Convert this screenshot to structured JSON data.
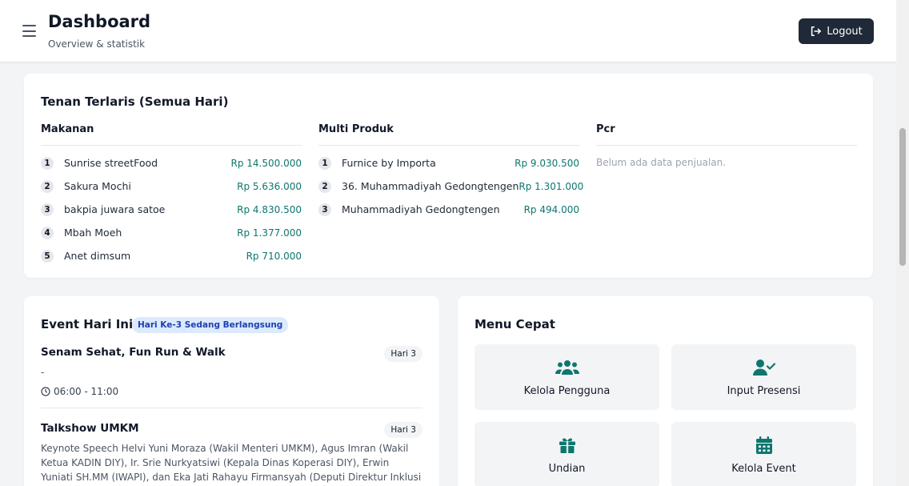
{
  "header": {
    "title": "Dashboard",
    "subtitle": "Overview & statistik",
    "logout_label": "Logout"
  },
  "top_tenants": {
    "title": "Tenan Terlaris (Semua Hari)",
    "columns": [
      {
        "name": "Makanan",
        "items": [
          {
            "rank": "1",
            "name": "Sunrise streetFood",
            "amount": "Rp 14.500.000"
          },
          {
            "rank": "2",
            "name": "Sakura Mochi",
            "amount": "Rp 5.636.000"
          },
          {
            "rank": "3",
            "name": "bakpia juwara satoe",
            "amount": "Rp 4.830.500"
          },
          {
            "rank": "4",
            "name": "Mbah Moeh",
            "amount": "Rp 1.377.000"
          },
          {
            "rank": "5",
            "name": "Anet dimsum",
            "amount": "Rp 710.000"
          }
        ]
      },
      {
        "name": "Multi Produk",
        "items": [
          {
            "rank": "1",
            "name": "Furnice by Importa",
            "amount": "Rp 9.030.500"
          },
          {
            "rank": "2",
            "name": "36. Muhammadiyah Gedongtengen",
            "amount": "Rp 1.301.000"
          },
          {
            "rank": "3",
            "name": "Muhammadiyah Gedongtengen",
            "amount": "Rp 494.000"
          }
        ]
      },
      {
        "name": "Pcr",
        "empty_text": "Belum ada data penjualan."
      }
    ]
  },
  "events": {
    "title": "Event Hari Ini",
    "status_badge": "Hari Ke-3 Sedang Berlangsung",
    "items": [
      {
        "title": "Senam Sehat, Fun Run & Walk",
        "day": "Hari 3",
        "description": "-",
        "time": "06:00 - 11:00"
      },
      {
        "title": "Talkshow UMKM",
        "day": "Hari 3",
        "description": "Keynote Speech Helvi Yuni Moraza (Wakil Menteri UMKM), Agus Imran (Wakil Ketua KADIN DIY), Ir. Srie Nurkyatsiwi (Kepala Dinas Koperasi DIY), Erwin Yuniati SH.MM (IWAPI), dan Eka Jati Rahayu Firmansyah (Deputi Direktur Inklusi Keuangan"
      }
    ]
  },
  "quick_menu": {
    "title": "Menu Cepat",
    "accent_color": "#0f766e",
    "items": [
      {
        "label": "Kelola Pengguna",
        "icon": "users-icon"
      },
      {
        "label": "Input Presensi",
        "icon": "user-check-icon"
      },
      {
        "label": "Undian",
        "icon": "gift-icon"
      },
      {
        "label": "Kelola Event",
        "icon": "calendar-icon"
      }
    ]
  }
}
